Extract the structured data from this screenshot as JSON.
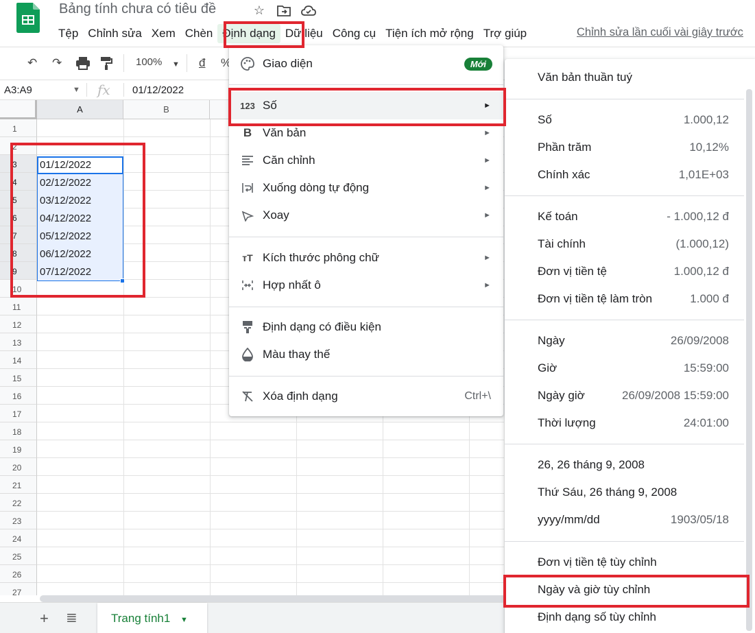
{
  "title_bar": {
    "doc_title": "Bảng tính chưa có tiêu đề",
    "icons": [
      "star-icon",
      "move-to-folder-icon",
      "cloud-status-icon"
    ]
  },
  "menubar": {
    "items": [
      "Tệp",
      "Chỉnh sửa",
      "Xem",
      "Chèn",
      "Định dạng",
      "Dữ liệu",
      "Công cụ",
      "Tiện ích mở rộng",
      "Trợ giúp"
    ],
    "last_edit": "Chỉnh sửa lần cuối vài giây trước"
  },
  "toolbar": {
    "zoom": "100%",
    "currency": "đ",
    "percent": "%"
  },
  "formula_bar": {
    "name_box": "A3:A9",
    "fx": "fx",
    "value": "01/12/2022"
  },
  "grid": {
    "columns": [
      "A",
      "B"
    ],
    "rows": [
      "1",
      "2",
      "3",
      "4",
      "5",
      "6",
      "7",
      "8",
      "9",
      "10",
      "11",
      "12",
      "13",
      "14",
      "15",
      "16",
      "17",
      "18",
      "19",
      "20",
      "21",
      "22",
      "23",
      "24",
      "25",
      "26",
      "27"
    ],
    "dates": [
      "01/12/2022",
      "02/12/2022",
      "03/12/2022",
      "04/12/2022",
      "05/12/2022",
      "06/12/2022",
      "07/12/2022"
    ]
  },
  "bottom": {
    "sheet_tab": "Trang tính1"
  },
  "format_menu": {
    "items": [
      {
        "label": "Giao diện",
        "icon": "palette-icon",
        "badge": "Mới"
      },
      {
        "label": "Số",
        "icon": "number-123-icon"
      },
      {
        "label": "Văn bản",
        "icon": "bold-icon"
      },
      {
        "label": "Căn chỉnh",
        "icon": "align-icon"
      },
      {
        "label": "Xuống dòng tự động",
        "icon": "wrap-icon"
      },
      {
        "label": "Xoay",
        "icon": "rotate-icon"
      },
      {
        "label": "Kích thước phông chữ",
        "icon": "font-size-icon"
      },
      {
        "label": "Hợp nhất ô",
        "icon": "merge-icon"
      },
      {
        "label": "Định dạng có điều kiện",
        "icon": "conditional-format-icon"
      },
      {
        "label": "Màu thay thế",
        "icon": "alternating-colors-icon"
      },
      {
        "label": "Xóa định dạng",
        "icon": "clear-format-icon",
        "shortcut": "Ctrl+\\"
      }
    ]
  },
  "number_submenu": {
    "items": [
      {
        "label": "Văn bản thuần tuý",
        "value": ""
      },
      {
        "label": "Số",
        "value": "1.000,12"
      },
      {
        "label": "Phần trăm",
        "value": "10,12%"
      },
      {
        "label": "Chính xác",
        "value": "1,01E+03"
      },
      {
        "label": "Kế toán",
        "value": "- 1.000,12 đ"
      },
      {
        "label": "Tài chính",
        "value": "(1.000,12)"
      },
      {
        "label": "Đơn vị tiền tệ",
        "value": "1.000,12 đ"
      },
      {
        "label": "Đơn vị tiền tệ làm tròn",
        "value": "1.000 đ"
      },
      {
        "label": "Ngày",
        "value": "26/09/2008"
      },
      {
        "label": "Giờ",
        "value": "15:59:00"
      },
      {
        "label": "Ngày giờ",
        "value": "26/09/2008 15:59:00"
      },
      {
        "label": "Thời lượng",
        "value": "24:01:00"
      },
      {
        "label": "26, 26 tháng 9, 2008",
        "value": ""
      },
      {
        "label": "Thứ Sáu, 26 tháng 9, 2008",
        "value": ""
      },
      {
        "label": "yyyy/mm/dd",
        "value": "1903/05/18"
      },
      {
        "label": "Đơn vị tiền tệ tùy chỉnh",
        "value": ""
      },
      {
        "label": "Ngày và giờ tùy chỉnh",
        "value": ""
      },
      {
        "label": "Định dạng số tùy chỉnh",
        "value": ""
      }
    ]
  },
  "colors": {
    "accent_green": "#188038",
    "highlight_red": "#e0262f",
    "selection_blue": "#1a73e8"
  }
}
